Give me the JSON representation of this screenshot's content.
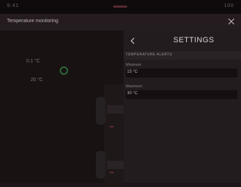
{
  "status_bar": {
    "left_text": "9:41",
    "right_text": "100"
  },
  "window": {
    "title": "Temperature monitoring",
    "close_icon": "close-icon"
  },
  "readings": {
    "reading_1": "0.1 °C",
    "reading_2": "20 °C"
  },
  "settings": {
    "title": "SETTINGS",
    "back_icon": "chevron-left-icon",
    "section_header": "TEMPERATURE ALERTS",
    "fields": [
      {
        "label": "Minimum",
        "value": "15 °C"
      },
      {
        "label": "Maximum",
        "value": "30 °C"
      }
    ]
  },
  "colors": {
    "background": "#1c1618",
    "panel": "#231c1e",
    "accent_red": "#8a2a33",
    "ring_green": "#2f6a3a"
  }
}
